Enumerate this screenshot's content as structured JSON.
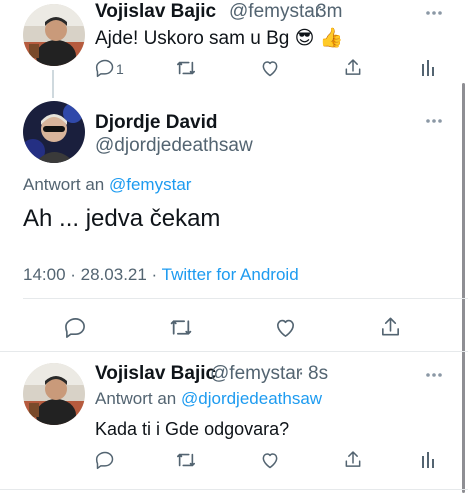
{
  "tweet1": {
    "author_name": "Vojislav Bajic",
    "handle": "@femystar",
    "separator": "·",
    "time": "3m",
    "text": "Ajde! Uskoro sam u Bg",
    "emoji_1": "😎",
    "emoji_2": "👍",
    "reply_count": "1"
  },
  "main_tweet": {
    "author_name": "Djordje David",
    "handle": "@djordjedeathsaw",
    "reply_prefix": "Antwort an",
    "reply_to": "@femystar",
    "text": "Ah ... jedva čekam",
    "timestamp": "14:00 · 28.03.21 ·",
    "source": "Twitter for Android"
  },
  "tweet3": {
    "author_name": "Vojislav Bajic",
    "handle": "@femystar",
    "separator": "·",
    "time": "8s",
    "reply_prefix": "Antwort an",
    "reply_to": "@djordjedeathsaw",
    "text": "Kada ti i Gde odgovara?"
  },
  "colors": {
    "accent": "#1d9bf0",
    "text": "#0f1419",
    "muted": "#536471",
    "divider": "#e6e9eb"
  },
  "icons": [
    "more-icon",
    "reply-icon",
    "retweet-icon",
    "like-icon",
    "share-icon",
    "analytics-icon"
  ]
}
